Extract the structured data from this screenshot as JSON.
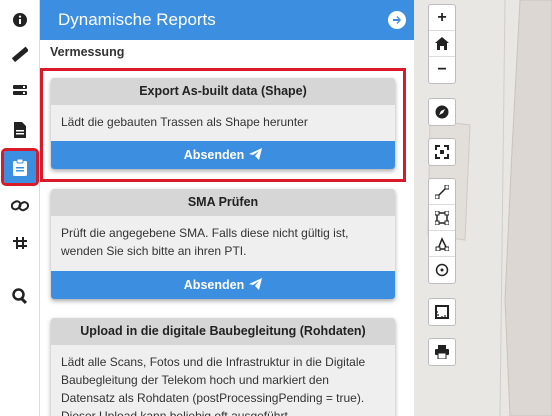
{
  "panel": {
    "title": "Dynamische Reports",
    "section": "Vermessung"
  },
  "cards": [
    {
      "title": "Export As-built data (Shape)",
      "description": "Lädt die gebauten Trassen als Shape herunter",
      "button": "Absenden"
    },
    {
      "title": "SMA Prüfen",
      "description": "Prüft die angegebene SMA. Falls diese nicht gültig ist, wenden Sie sich bitte an ihren PTI.",
      "button": "Absenden"
    },
    {
      "title": "Upload in die digitale Baubegleitung (Rohdaten)",
      "description": "Lädt alle Scans, Fotos und die Infrastruktur in die Digitale Baubegleitung der Telekom hoch und markiert den Datensatz als Rohdaten (postProcessingPending = true). Dieser Upload kann beliebig oft ausgeführt"
    }
  ],
  "rail_icons": [
    "info-icon",
    "ruler-icon",
    "layers-icon",
    "document-icon",
    "clipboard-icon",
    "link-icon",
    "network-icon",
    "search-zoom-icon"
  ],
  "map_controls": {
    "zoom_in": "+",
    "zoom_out": "−"
  },
  "colors": {
    "accent": "#3c8fe0",
    "highlight": "#d81b2a"
  }
}
